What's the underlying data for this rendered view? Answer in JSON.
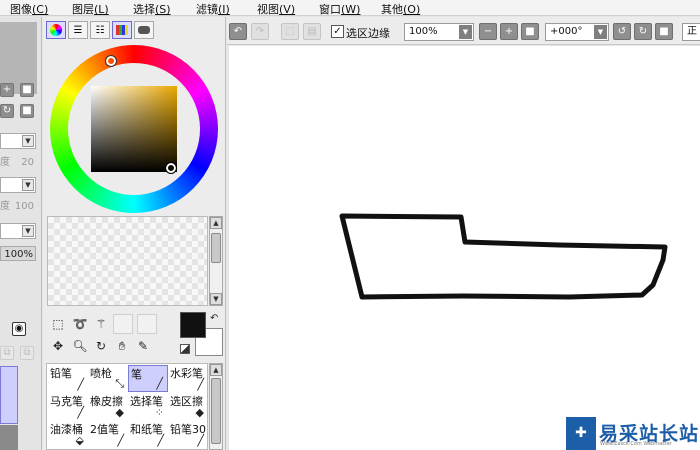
{
  "menubar": {
    "items": [
      {
        "label": "图像",
        "key": "(C)"
      },
      {
        "label": "图层",
        "key": "(L)"
      },
      {
        "label": "选择",
        "key": "(S)"
      },
      {
        "label": "滤镜",
        "key": "(I)"
      },
      {
        "label": "视图",
        "key": "(V)"
      },
      {
        "label": "窗口",
        "key": "(W)"
      },
      {
        "label": "其他",
        "key": "(O)"
      }
    ]
  },
  "left_strip": {
    "field1": {
      "label": "度",
      "value": "20"
    },
    "field2": {
      "label": "度",
      "value": "100"
    },
    "field3": {
      "value": "100%"
    }
  },
  "color_panel": {
    "hue_color": "#e9a800",
    "foreground_color": "#111111",
    "background_color": "#ffffff"
  },
  "brushes": [
    {
      "label": "铅笔",
      "icon": "pencil-icon"
    },
    {
      "label": "喷枪",
      "icon": "airbrush-icon"
    },
    {
      "label": "笔",
      "icon": "pen-icon"
    },
    {
      "label": "水彩笔",
      "icon": "watercolor-icon"
    },
    {
      "label": "马克笔",
      "icon": "marker-icon"
    },
    {
      "label": "橡皮擦",
      "icon": "eraser-icon"
    },
    {
      "label": "选择笔",
      "icon": "select-pen-icon"
    },
    {
      "label": "选区擦",
      "icon": "select-eraser-icon"
    },
    {
      "label": "油漆桶",
      "icon": "bucket-icon"
    },
    {
      "label": "2值笔",
      "icon": "binary-pen-icon"
    },
    {
      "label": "和纸笔",
      "icon": "paper-pen-icon"
    },
    {
      "label": "铅笔30",
      "icon": "pencil30-icon"
    }
  ],
  "toolbar": {
    "selection_edge_label": "选区边缘",
    "selection_edge_checked": "✓",
    "zoom_value": "100%",
    "rotation_value": "+000°",
    "mode_label": "正"
  },
  "watermark": {
    "title": "易采站长站",
    "url": "Www.Easck.Com Webmaster"
  }
}
